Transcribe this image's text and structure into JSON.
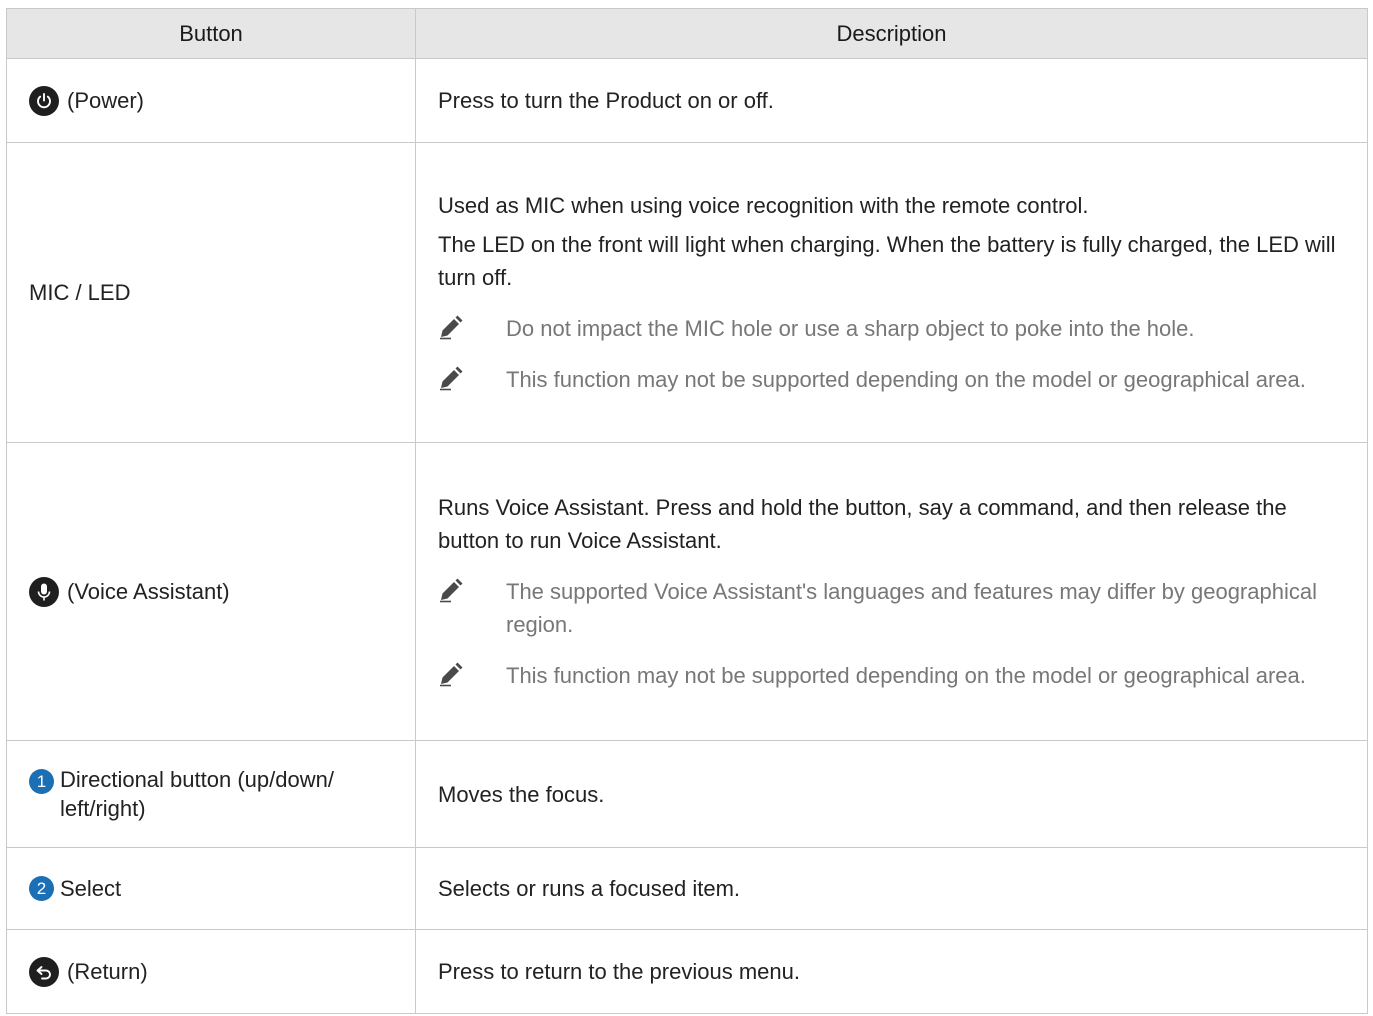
{
  "table": {
    "headers": [
      "Button",
      "Description"
    ],
    "rows": [
      {
        "icon": "power-icon",
        "label": "(Power)",
        "description": [
          "Press to turn the Product on or off."
        ],
        "notes": []
      },
      {
        "icon": "",
        "label": "MIC / LED",
        "description": [
          "Used as MIC when using voice recognition with the remote control.",
          "The LED on the front will light when charging. When the battery is fully charged, the LED will turn off."
        ],
        "notes": [
          "Do not impact the MIC hole or use a sharp object to poke into the hole.",
          "This function may not be supported depending on the model or geographical area."
        ]
      },
      {
        "icon": "microphone-icon",
        "label": "(Voice Assistant)",
        "description": [
          "Runs Voice Assistant. Press and hold the button, say a command, and then release the button to run Voice Assistant."
        ],
        "notes": [
          "The supported Voice Assistant's languages and features may differ by geographical region.",
          "This function may not be supported depending on the model or geographical area."
        ]
      },
      {
        "number": "1",
        "label": "Directional button (up/down/ left/right)",
        "description": [
          "Moves the focus."
        ],
        "notes": []
      },
      {
        "number": "2",
        "label": "Select",
        "description": [
          "Selects or runs a focused item."
        ],
        "notes": []
      },
      {
        "icon": "return-icon",
        "label": "(Return)",
        "description": [
          "Press to return to the previous menu."
        ],
        "notes": []
      }
    ]
  },
  "colors": {
    "header_bg": "#e6e6e6",
    "border": "#c9c9c9",
    "note_text": "#777777",
    "number_badge": "#1b6fb5",
    "icon_bg": "#1f1f1f"
  }
}
